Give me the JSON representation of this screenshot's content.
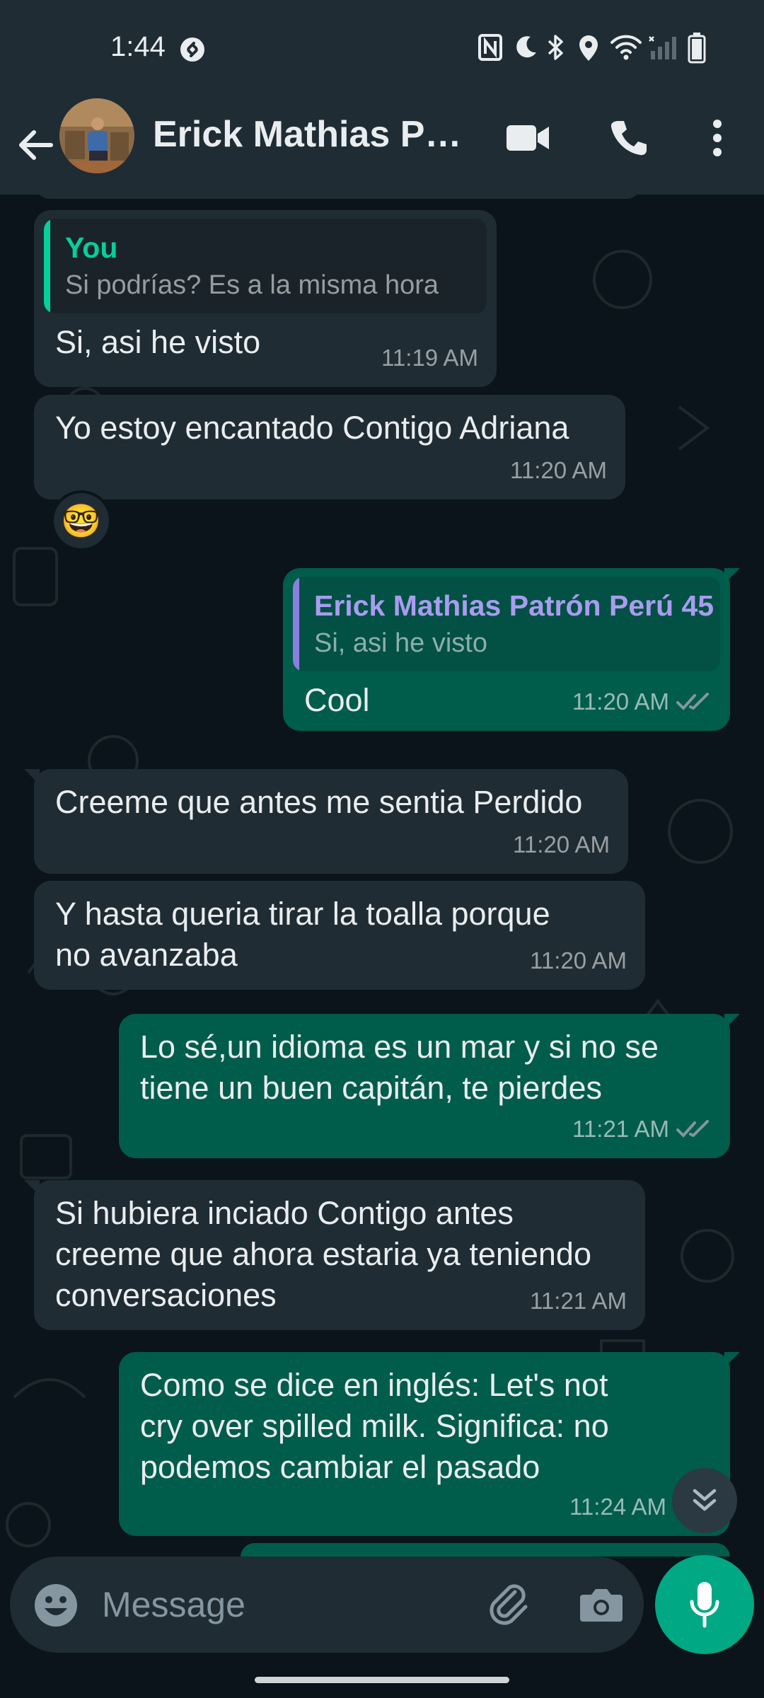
{
  "status_bar": {
    "time": "1:44",
    "icons": [
      "shazam-icon",
      "nfc-icon",
      "dnd-moon-icon",
      "bluetooth-icon",
      "location-icon",
      "wifi-icon",
      "signal-icon",
      "battery-icon"
    ]
  },
  "header": {
    "contact_name": "Erick Mathias Pa...",
    "icons": [
      "back-arrow-icon",
      "video-call-icon",
      "voice-call-icon",
      "more-vert-icon"
    ]
  },
  "messages": [
    {
      "direction": "in",
      "quote": {
        "author": "You",
        "text": "Si podrías? Es a la misma hora"
      },
      "text": "Si, asi he visto",
      "time": "11:19 AM"
    },
    {
      "direction": "in",
      "text": "Yo estoy encantado Contigo Adriana",
      "time": "11:20 AM",
      "reaction": "🤓"
    },
    {
      "direction": "out",
      "quote": {
        "author": "Erick Mathias Patrón Perú 45",
        "text": "Si, asi he visto"
      },
      "text": "Cool",
      "time": "11:20 AM",
      "status": "read"
    },
    {
      "direction": "in",
      "text": "Creeme que antes me sentia Perdido",
      "time": "11:20 AM"
    },
    {
      "direction": "in",
      "text": "Y hasta queria tirar la toalla porque\nno avanzaba",
      "time": "11:20 AM"
    },
    {
      "direction": "out",
      "text": "Lo sé,un idioma es un mar y si no se\ntiene un buen capitán, te pierdes",
      "time": "11:21 AM",
      "status": "read"
    },
    {
      "direction": "in",
      "text": "Si hubiera inciado Contigo antes\ncreeme que ahora estaria ya teniendo\nconversaciones",
      "time": "11:21 AM"
    },
    {
      "direction": "out",
      "text": "Como se dice en inglés: Let's not\ncry over spilled milk. Significa: no\npodemos cambiar el pasado",
      "time": "11:24 AM"
    }
  ],
  "composer": {
    "placeholder": "Message",
    "icons": [
      "emoji-icon",
      "attach-icon",
      "camera-icon",
      "mic-icon"
    ]
  },
  "scroll_down_icon": "double-chevron-down-icon",
  "colors": {
    "background": "#0b141a",
    "header": "#1f2c34",
    "incoming_bubble": "#202c33",
    "outgoing_bubble": "#005c4b",
    "accent": "#00a884",
    "quote_you": "#06cf9c",
    "quote_contact": "#8b7ee0"
  }
}
